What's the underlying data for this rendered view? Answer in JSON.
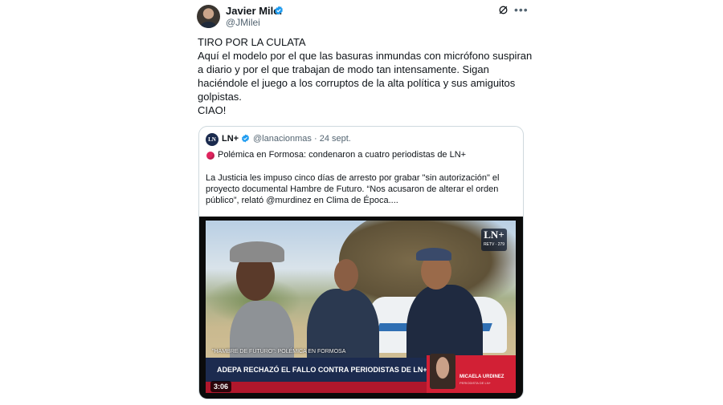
{
  "tweet": {
    "author_name": "Javier Milei",
    "author_handle": "@JMilei",
    "text_lines": [
      "TIRO POR LA CULATA",
      "Aquí el modelo por el que las basuras inmundas con micrófono suspiran",
      "a diario y por el que trabajan de modo tan intensamente. Sigan",
      "haciéndole el juego a los corruptos de la alta política y sus amiguitos",
      "golpistas.",
      "CIAO!"
    ],
    "more_icon": "more-icon",
    "grok_icon": "grok-icon"
  },
  "quote": {
    "logo_text": "LN",
    "author_name": "LN+",
    "author_handle": "@lanacionmas",
    "date": "· 24 sept.",
    "headline": "Polémica en Formosa: condenaron a cuatro periodistas de LN+",
    "body_lines": [
      "La Justicia les impuso cinco días de arresto por grabar \"sin autorización\" el",
      "proyecto documental Hambre de Futuro. “Nos acusaron de alterar el orden",
      "público”, relató @murdinez en Clima de Época...."
    ]
  },
  "video": {
    "badge_main": "LN+",
    "badge_sub": "RETV · 279",
    "lower_tag": "\"HAMBRE DE FUTURO\": POLÉMICA EN FORMOSA",
    "ticker": "ADEPA RECHAZÓ EL FALLO CONTRA PERIODISTAS DE LN+",
    "guest_name": "MICAELA URDINEZ",
    "guest_role": "PERIODISTA DE LN+",
    "duration": "3:06"
  },
  "colors": {
    "verified": "#1d9bf0",
    "ticker_bg": "#1c2b4f",
    "ticker_red": "#b0172c",
    "red_dot": "#e0245e"
  }
}
